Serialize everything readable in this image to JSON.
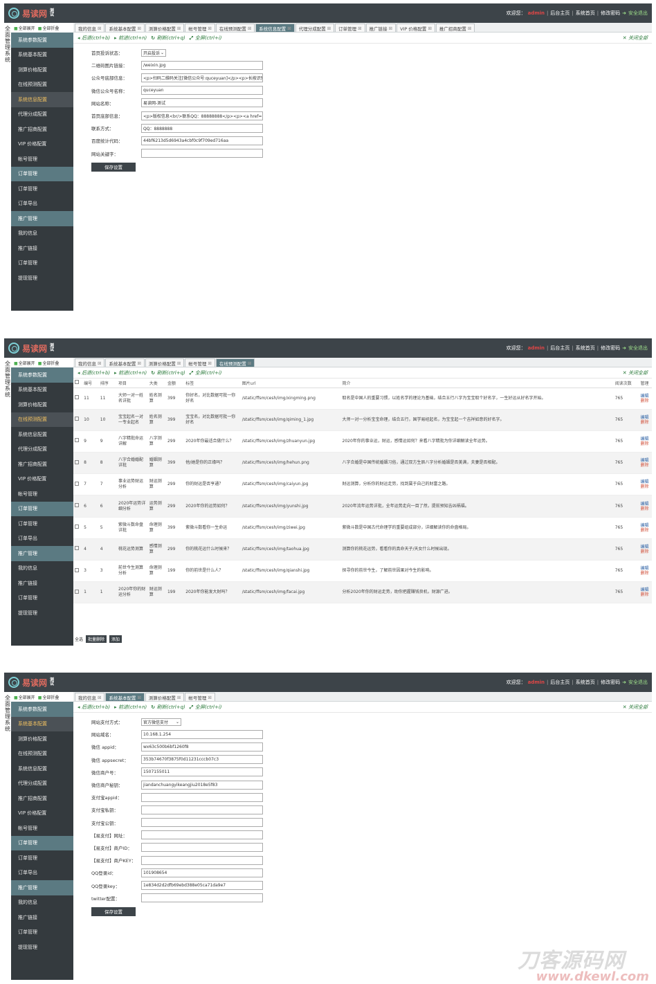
{
  "brand": {
    "name": "易读网",
    "sub": "测试"
  },
  "topbar": {
    "greet": "欢迎您：",
    "user": "admin",
    "links": [
      "后台主页",
      "系统首页",
      "修改密码"
    ],
    "exit": "安全退出"
  },
  "vnav": "全面管理系统",
  "sidebar": {
    "top": [
      "全部展开",
      "全部折叠"
    ],
    "items": [
      {
        "label": "系统参数配置",
        "type": "group"
      },
      {
        "label": "系统基本配置",
        "type": "item"
      },
      {
        "label": "测算价格配置",
        "type": "item"
      },
      {
        "label": "在线预测配置",
        "type": "item"
      },
      {
        "label": "系统信息配置",
        "type": "item"
      },
      {
        "label": "代理分成配置",
        "type": "item"
      },
      {
        "label": "推广招商配置",
        "type": "item"
      },
      {
        "label": "VIP 价格配置",
        "type": "item"
      },
      {
        "label": "帐号管理",
        "type": "item"
      },
      {
        "label": "订单管理",
        "type": "group"
      },
      {
        "label": "订单管理",
        "type": "item"
      },
      {
        "label": "订单导出",
        "type": "item"
      },
      {
        "label": "推广管理",
        "type": "group"
      },
      {
        "label": "我的信息",
        "type": "item"
      },
      {
        "label": "推广链接",
        "type": "item"
      },
      {
        "label": "订单管理",
        "type": "item"
      },
      {
        "label": "提现管理",
        "type": "item"
      }
    ]
  },
  "toolbar": {
    "back": "后退(ctrl+b)",
    "forward": "前进(ctrl+n)",
    "refresh": "刷新(ctrl+q)",
    "full": "全屏(ctrl+i)",
    "close": "关闭全部"
  },
  "shot1": {
    "tabs": [
      "我的信息",
      "系统基本配置",
      "测算价格配置",
      "帐号管理",
      "在线预测配置",
      "系统信息配置",
      "代理分成配置",
      "订单管理",
      "推广链接",
      "VIP 价格配置",
      "推广招商配置"
    ],
    "active_tab": 5,
    "active_side": 4,
    "rows": [
      {
        "label": "首页投诉状态：",
        "value": "开启投诉",
        "type": "select"
      },
      {
        "label": "二维码图片链接：",
        "value": "/weixin.jpg"
      },
      {
        "label": "公众号底部信息：",
        "value": "<p>扫码二维码关注[微信公众号:quceyuan]</p><p>长按识别"
      },
      {
        "label": "微信公众号名称：",
        "value": "quceyuan"
      },
      {
        "label": "网站名称：",
        "value": "易读网-测试"
      },
      {
        "label": "首页底部信息：",
        "value": "<p>版权信息<br/>联系QQ：88888888</p><p><a href=\"/?ac=sb"
      },
      {
        "label": "联系方式：",
        "value": "QQ：8888888"
      },
      {
        "label": "百度统计代码：",
        "value": "44bf6213d5d6943a4cbf0c9f709ed716aa"
      },
      {
        "label": "网站关键字：",
        "value": ""
      }
    ],
    "save": "保存设置"
  },
  "shot2": {
    "tabs": [
      "我的信息",
      "系统基本配置",
      "测算价格配置",
      "帐号管理",
      "在线预测配置"
    ],
    "active_tab": 4,
    "active_side": 3,
    "headers": [
      "",
      "编号",
      "排序",
      "项目",
      "大类",
      "金额",
      "标签",
      "图片url",
      "简介",
      "阅读次数",
      "管理"
    ],
    "rows": [
      {
        "id": "11",
        "sort": "11",
        "name": "大师一对一姓名详批",
        "cat": "姓名测算",
        "price": "399",
        "tag": "你好名，对比数据可批一你好名",
        "url": "/static/ffsm/cesh/img/xingming.png",
        "desc": "取名是中国人的重要习惯，以姓名学的理论为基础，结合五行八字为宝宝取个好名字，一生好运从好名字开始。",
        "reads": "765"
      },
      {
        "id": "10",
        "sort": "10",
        "name": "宝宝起名一对一专业起名",
        "cat": "姓名测算",
        "price": "399",
        "tag": "宝宝名，对比数据可批一你好名",
        "url": "/static/ffsm/cesh/img/qiming_1.jpg",
        "desc": "大师一对一分析宝宝命理，结合五行，国学易经起名，为宝宝起一个吉祥如意的好名字。",
        "reads": "765"
      },
      {
        "id": "9",
        "sort": "9",
        "name": "八字精批命运详解",
        "cat": "八字测算",
        "price": "299",
        "tag": "2020年你最适合做什么？",
        "url": "/static/ffsm/cesh/img/zhuanyun.jpg",
        "desc": "2020年你的事业运，财运，感情运如何？来看八字精批为你详细解读全年运势。",
        "reads": "765"
      },
      {
        "id": "8",
        "sort": "8",
        "name": "八字合婚婚配详批",
        "cat": "婚姻测算",
        "price": "399",
        "tag": "他/她是你的正缘吗？",
        "url": "/static/ffsm/cesh/img/hehun.png",
        "desc": "八字合婚是中国传统婚姻习俗，通过双方生辰八字分析婚姻是否美满，夫妻是否相配。",
        "reads": "765"
      },
      {
        "id": "7",
        "sort": "7",
        "name": "事业运势财运分析",
        "cat": "财运测算",
        "price": "299",
        "tag": "你的财运是否亨通？",
        "url": "/static/ffsm/cesh/img/caiyun.jpg",
        "desc": "财运测算，分析你的财运走势，找到属于自己的财富之路。",
        "reads": "765"
      },
      {
        "id": "6",
        "sort": "6",
        "name": "2020年运势详细分析",
        "cat": "运势测算",
        "price": "299",
        "tag": "2020年你的运势如何？",
        "url": "/static/ffsm/cesh/img/yunshi.jpg",
        "desc": "2020年流年运势详批，全年运势走向一目了然，提前预知吉凶祸福。",
        "reads": "765"
      },
      {
        "id": "5",
        "sort": "5",
        "name": "紫微斗数命盘详批",
        "cat": "命理测算",
        "price": "399",
        "tag": "紫微斗数看你一生命运",
        "url": "/static/ffsm/cesh/img/ziwei.jpg",
        "desc": "紫微斗数是中国古代命理学的重要组成部分，详细解读你的命盘格局。",
        "reads": "765"
      },
      {
        "id": "4",
        "sort": "4",
        "name": "桃花运势测算",
        "cat": "感情测算",
        "price": "299",
        "tag": "你的桃花运什么时候来？",
        "url": "/static/ffsm/cesh/img/taohua.jpg",
        "desc": "测算你的桃花运势，看看你的真命天子/天女什么时候出现。",
        "reads": "765"
      },
      {
        "id": "3",
        "sort": "3",
        "name": "前世今生测算分析",
        "cat": "命理测算",
        "price": "199",
        "tag": "你的前世是什么人？",
        "url": "/static/ffsm/cesh/img/qianshi.jpg",
        "desc": "探寻你的前世今生，了解前世因果对今生的影响。",
        "reads": "765"
      },
      {
        "id": "1",
        "sort": "1",
        "name": "2020年你的财运分析",
        "cat": "财运测算",
        "price": "199",
        "tag": "2020年你能发大财吗？",
        "url": "/static/ffsm/cesh/img/facai.jpg",
        "desc": "分析2020年你的财运走势，助你把握赚钱良机，财源广进。",
        "reads": "765"
      }
    ],
    "ops": [
      "编辑",
      "删除"
    ],
    "footer": {
      "all": "全选",
      "delete": "批量删除",
      "add": "添加"
    }
  },
  "shot3": {
    "tabs": [
      "我的信息",
      "系统基本配置",
      "测算价格配置",
      "帐号管理"
    ],
    "active_tab": 1,
    "active_side": 1,
    "rows": [
      {
        "label": "网站支付方式：",
        "value": "官方微信支付",
        "type": "select"
      },
      {
        "label": "网站域名：",
        "value": "10.168.1.254"
      },
      {
        "label": "微信 appid：",
        "value": "wx63c500b6bf1260f8"
      },
      {
        "label": "微信 appsecret：",
        "value": "353b74670f3875f0d11231cccb07c3"
      },
      {
        "label": "微信商户号：",
        "value": "1507155011"
      },
      {
        "label": "微信商户秘钥：",
        "value": "jiandanchuangyikeangjiu2018e5f83"
      },
      {
        "label": "支付宝appid：",
        "value": ""
      },
      {
        "label": "支付宝私钥：",
        "value": ""
      },
      {
        "label": "支付宝公钥：",
        "value": ""
      },
      {
        "label": "【易支付】网址：",
        "value": ""
      },
      {
        "label": "【易支付】商户ID：",
        "value": ""
      },
      {
        "label": "【易支付】商户KEY：",
        "value": ""
      },
      {
        "label": "QQ登录id：",
        "value": "101908654"
      },
      {
        "label": "QQ登录key：",
        "value": "1e834d2d2dfb69ebd388e05ca71da9e7"
      },
      {
        "label": "twitter配置：",
        "value": ""
      }
    ],
    "save": "保存设置"
  },
  "watermark": {
    "cn": "刀客源码网",
    "url": "www.dkewl.com"
  }
}
